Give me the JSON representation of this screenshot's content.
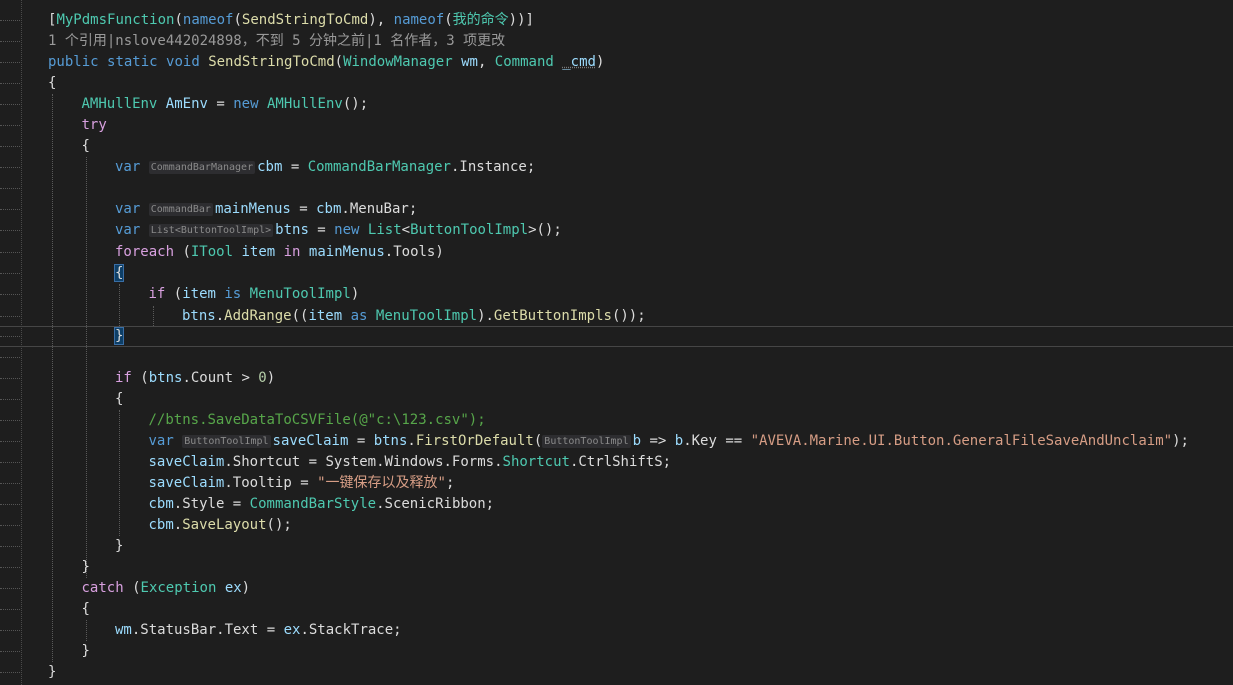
{
  "editor": {
    "lines": [
      {
        "indent": 0,
        "tokens": [
          {
            "t": "[",
            "c": "punc"
          },
          {
            "t": "MyPdmsFunction",
            "c": "type"
          },
          {
            "t": "(",
            "c": "punc"
          },
          {
            "t": "nameof",
            "c": "kw"
          },
          {
            "t": "(",
            "c": "punc"
          },
          {
            "t": "SendStringToCmd",
            "c": "method"
          },
          {
            "t": "), ",
            "c": "punc"
          },
          {
            "t": "nameof",
            "c": "kw"
          },
          {
            "t": "(",
            "c": "punc"
          },
          {
            "t": "我的命令",
            "c": "type"
          },
          {
            "t": "))]",
            "c": "punc"
          }
        ]
      },
      {
        "indent": 0,
        "codelens": true,
        "tokens": [
          {
            "t": "1 个引用|nslove442024898，不到 5 分钟之前|1 名作者，3 项更改",
            "c": "lens"
          }
        ]
      },
      {
        "indent": 0,
        "tokens": [
          {
            "t": "public",
            "c": "kw"
          },
          {
            "t": " ",
            "c": "punc"
          },
          {
            "t": "static",
            "c": "kw"
          },
          {
            "t": " ",
            "c": "punc"
          },
          {
            "t": "void",
            "c": "kw"
          },
          {
            "t": " ",
            "c": "punc"
          },
          {
            "t": "SendStringToCmd",
            "c": "method"
          },
          {
            "t": "(",
            "c": "punc"
          },
          {
            "t": "WindowManager",
            "c": "type"
          },
          {
            "t": " ",
            "c": "punc"
          },
          {
            "t": "wm",
            "c": "ident"
          },
          {
            "t": ", ",
            "c": "punc"
          },
          {
            "t": "Command",
            "c": "type"
          },
          {
            "t": " ",
            "c": "punc"
          },
          {
            "t": "_cmd",
            "c": "ident squig"
          },
          {
            "t": ")",
            "c": "punc"
          }
        ]
      },
      {
        "indent": 0,
        "tokens": [
          {
            "t": "{",
            "c": "punc"
          }
        ]
      },
      {
        "indent": 1,
        "tokens": [
          {
            "t": "AMHullEnv",
            "c": "type"
          },
          {
            "t": " ",
            "c": "punc"
          },
          {
            "t": "AmEnv",
            "c": "ident"
          },
          {
            "t": " = ",
            "c": "punc"
          },
          {
            "t": "new",
            "c": "kw"
          },
          {
            "t": " ",
            "c": "punc"
          },
          {
            "t": "AMHullEnv",
            "c": "type"
          },
          {
            "t": "();",
            "c": "punc"
          }
        ]
      },
      {
        "indent": 1,
        "tokens": [
          {
            "t": "try",
            "c": "ctl"
          }
        ]
      },
      {
        "indent": 1,
        "tokens": [
          {
            "t": "{",
            "c": "punc"
          }
        ]
      },
      {
        "indent": 2,
        "tokens": [
          {
            "t": "var",
            "c": "kw"
          },
          {
            "t": " ",
            "c": "punc"
          },
          {
            "t": "CommandBarManager",
            "c": "hint"
          },
          {
            "t": "cbm",
            "c": "ident"
          },
          {
            "t": " = ",
            "c": "punc"
          },
          {
            "t": "CommandBarManager",
            "c": "type"
          },
          {
            "t": ".Instance;",
            "c": "punc"
          }
        ]
      },
      {
        "indent": 0,
        "tokens": []
      },
      {
        "indent": 2,
        "tokens": [
          {
            "t": "var",
            "c": "kw"
          },
          {
            "t": " ",
            "c": "punc"
          },
          {
            "t": "CommandBar",
            "c": "hint"
          },
          {
            "t": "mainMenus",
            "c": "ident"
          },
          {
            "t": " = ",
            "c": "punc"
          },
          {
            "t": "cbm",
            "c": "ident"
          },
          {
            "t": ".MenuBar;",
            "c": "punc"
          }
        ]
      },
      {
        "indent": 2,
        "tokens": [
          {
            "t": "var",
            "c": "kw"
          },
          {
            "t": " ",
            "c": "punc"
          },
          {
            "t": "List<ButtonToolImpl>",
            "c": "hint"
          },
          {
            "t": "btns",
            "c": "ident"
          },
          {
            "t": " = ",
            "c": "punc"
          },
          {
            "t": "new",
            "c": "kw"
          },
          {
            "t": " ",
            "c": "punc"
          },
          {
            "t": "List",
            "c": "type"
          },
          {
            "t": "<",
            "c": "punc"
          },
          {
            "t": "ButtonToolImpl",
            "c": "type"
          },
          {
            "t": ">();",
            "c": "punc"
          }
        ]
      },
      {
        "indent": 2,
        "tokens": [
          {
            "t": "foreach",
            "c": "ctl"
          },
          {
            "t": " (",
            "c": "punc"
          },
          {
            "t": "ITool",
            "c": "type"
          },
          {
            "t": " ",
            "c": "punc"
          },
          {
            "t": "item",
            "c": "ident"
          },
          {
            "t": " ",
            "c": "punc"
          },
          {
            "t": "in",
            "c": "ctl"
          },
          {
            "t": " ",
            "c": "punc"
          },
          {
            "t": "mainMenus",
            "c": "ident"
          },
          {
            "t": ".Tools)",
            "c": "punc"
          }
        ]
      },
      {
        "indent": 2,
        "tokens": [
          {
            "t": "{",
            "c": "punc brace-hl"
          }
        ]
      },
      {
        "indent": 3,
        "tokens": [
          {
            "t": "if",
            "c": "ctl"
          },
          {
            "t": " (",
            "c": "punc"
          },
          {
            "t": "item",
            "c": "ident"
          },
          {
            "t": " ",
            "c": "punc"
          },
          {
            "t": "is",
            "c": "kw"
          },
          {
            "t": " ",
            "c": "punc"
          },
          {
            "t": "MenuToolImpl",
            "c": "type"
          },
          {
            "t": ")",
            "c": "punc"
          }
        ]
      },
      {
        "indent": 4,
        "tokens": [
          {
            "t": "btns",
            "c": "ident"
          },
          {
            "t": ".",
            "c": "punc"
          },
          {
            "t": "AddRange",
            "c": "method"
          },
          {
            "t": "((",
            "c": "punc"
          },
          {
            "t": "item",
            "c": "ident"
          },
          {
            "t": " ",
            "c": "punc"
          },
          {
            "t": "as",
            "c": "kw"
          },
          {
            "t": " ",
            "c": "punc"
          },
          {
            "t": "MenuToolImpl",
            "c": "type"
          },
          {
            "t": ").",
            "c": "punc"
          },
          {
            "t": "GetButtonImpls",
            "c": "method"
          },
          {
            "t": "());",
            "c": "punc"
          }
        ]
      },
      {
        "indent": 2,
        "current": true,
        "tokens": [
          {
            "t": "}",
            "c": "punc brace-hl"
          }
        ]
      },
      {
        "indent": 0,
        "tokens": []
      },
      {
        "indent": 2,
        "tokens": [
          {
            "t": "if",
            "c": "ctl"
          },
          {
            "t": " (",
            "c": "punc"
          },
          {
            "t": "btns",
            "c": "ident"
          },
          {
            "t": ".Count > ",
            "c": "punc"
          },
          {
            "t": "0",
            "c": "num"
          },
          {
            "t": ")",
            "c": "punc"
          }
        ]
      },
      {
        "indent": 2,
        "tokens": [
          {
            "t": "{",
            "c": "punc"
          }
        ]
      },
      {
        "indent": 3,
        "tokens": [
          {
            "t": "//btns.SaveDataToCSVFile(@\"c:\\123.csv\");",
            "c": "cmt"
          }
        ]
      },
      {
        "indent": 3,
        "tokens": [
          {
            "t": "var",
            "c": "kw"
          },
          {
            "t": " ",
            "c": "punc"
          },
          {
            "t": "ButtonToolImpl",
            "c": "hint"
          },
          {
            "t": "saveClaim",
            "c": "ident"
          },
          {
            "t": " = ",
            "c": "punc"
          },
          {
            "t": "btns",
            "c": "ident"
          },
          {
            "t": ".",
            "c": "punc"
          },
          {
            "t": "FirstOrDefault",
            "c": "method"
          },
          {
            "t": "(",
            "c": "punc"
          },
          {
            "t": "ButtonToolImpl",
            "c": "hint"
          },
          {
            "t": "b",
            "c": "ident"
          },
          {
            "t": " => ",
            "c": "punc"
          },
          {
            "t": "b",
            "c": "ident"
          },
          {
            "t": ".Key == ",
            "c": "punc"
          },
          {
            "t": "\"AVEVA.Marine.UI.Button.GeneralFileSaveAndUnclaim\"",
            "c": "str"
          },
          {
            "t": ");",
            "c": "punc"
          }
        ]
      },
      {
        "indent": 3,
        "tokens": [
          {
            "t": "saveClaim",
            "c": "ident"
          },
          {
            "t": ".Shortcut = System.Windows.Forms.",
            "c": "punc"
          },
          {
            "t": "Shortcut",
            "c": "type"
          },
          {
            "t": ".CtrlShiftS;",
            "c": "punc"
          }
        ]
      },
      {
        "indent": 3,
        "tokens": [
          {
            "t": "saveClaim",
            "c": "ident"
          },
          {
            "t": ".Tooltip = ",
            "c": "punc"
          },
          {
            "t": "\"一键保存以及释放\"",
            "c": "str"
          },
          {
            "t": ";",
            "c": "punc"
          }
        ]
      },
      {
        "indent": 3,
        "tokens": [
          {
            "t": "cbm",
            "c": "ident"
          },
          {
            "t": ".Style = ",
            "c": "punc"
          },
          {
            "t": "CommandBarStyle",
            "c": "type"
          },
          {
            "t": ".ScenicRibbon;",
            "c": "punc"
          }
        ]
      },
      {
        "indent": 3,
        "tokens": [
          {
            "t": "cbm",
            "c": "ident"
          },
          {
            "t": ".",
            "c": "punc"
          },
          {
            "t": "SaveLayout",
            "c": "method"
          },
          {
            "t": "();",
            "c": "punc"
          }
        ]
      },
      {
        "indent": 2,
        "tokens": [
          {
            "t": "}",
            "c": "punc"
          }
        ]
      },
      {
        "indent": 1,
        "tokens": [
          {
            "t": "}",
            "c": "punc"
          }
        ]
      },
      {
        "indent": 1,
        "tokens": [
          {
            "t": "catch",
            "c": "ctl"
          },
          {
            "t": " (",
            "c": "punc"
          },
          {
            "t": "Exception",
            "c": "type"
          },
          {
            "t": " ",
            "c": "punc"
          },
          {
            "t": "ex",
            "c": "ident"
          },
          {
            "t": ")",
            "c": "punc"
          }
        ]
      },
      {
        "indent": 1,
        "tokens": [
          {
            "t": "{",
            "c": "punc"
          }
        ]
      },
      {
        "indent": 2,
        "tokens": [
          {
            "t": "wm",
            "c": "ident"
          },
          {
            "t": ".StatusBar.Text = ",
            "c": "punc"
          },
          {
            "t": "ex",
            "c": "ident"
          },
          {
            "t": ".StackTrace;",
            "c": "punc"
          }
        ]
      },
      {
        "indent": 1,
        "tokens": [
          {
            "t": "}",
            "c": "punc"
          }
        ]
      },
      {
        "indent": 0,
        "tokens": [
          {
            "t": "}",
            "c": "punc"
          }
        ]
      }
    ]
  }
}
